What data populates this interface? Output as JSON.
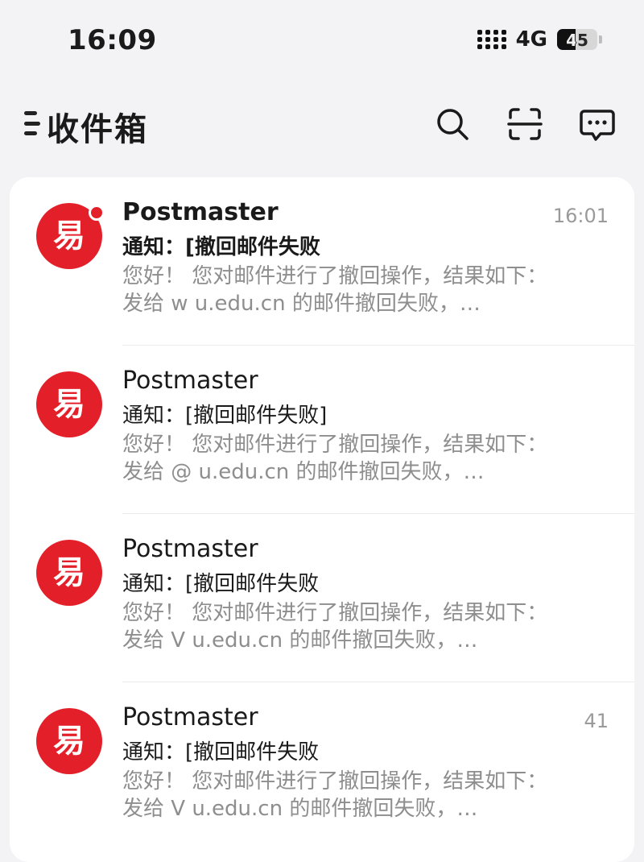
{
  "status_bar": {
    "time": "16:09",
    "network": "4G",
    "battery": "45",
    "battery_level": 0.45
  },
  "header": {
    "title": "收件箱"
  },
  "mails": [
    {
      "sender": "Postmaster",
      "time": "16:01",
      "subject": "通知：[撤回邮件失败",
      "preview_line1": "您好！ 您对邮件进行了撤回操作，结果如下：",
      "preview_line2": "发给 w        u.edu.cn 的邮件撤回失败，…",
      "unread": true
    },
    {
      "sender": "Postmaster",
      "time": "",
      "subject": "通知：[撤回邮件失败]",
      "preview_line1": "您好！ 您对邮件进行了撤回操作，结果如下：",
      "preview_line2": "发给      @    u.edu.cn 的邮件撤回失败，…",
      "unread": false
    },
    {
      "sender": "Postmaster",
      "time": "",
      "subject": "通知：[撤回邮件失败",
      "preview_line1": "您好！ 您对邮件进行了撤回操作，结果如下：",
      "preview_line2": "发给 V          u.edu.cn 的邮件撤回失败，…",
      "unread": false
    },
    {
      "sender": "Postmaster",
      "time": "41",
      "subject": "通知：[撤回邮件失败",
      "preview_line1": "您好！ 您对邮件进行了撤回操作，结果如下：",
      "preview_line2": "发给 V        u.edu.cn 的邮件撤回失败，…",
      "unread": false
    }
  ],
  "colors": {
    "brand_red": "#e3202a",
    "background": "#f3f3f5",
    "muted_text": "#8e8e8e"
  },
  "icons": {
    "menu": "menu-icon",
    "search": "search-icon",
    "scan": "scan-icon",
    "chat": "chat-icon",
    "avatar": "netease-mail-logo"
  }
}
